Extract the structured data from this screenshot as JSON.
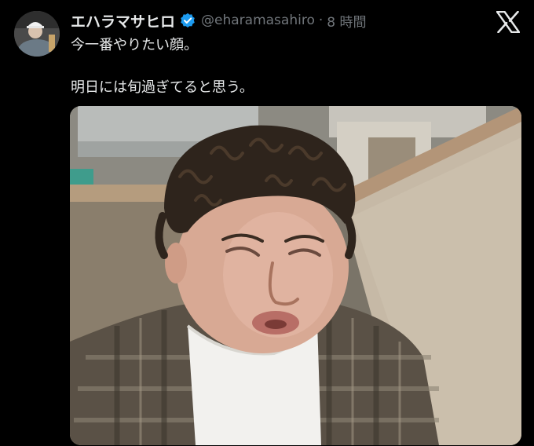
{
  "tweet": {
    "display_name": "エハラマサヒロ",
    "handle": "@eharamasahiro",
    "separator": "·",
    "time": "8 時間",
    "text_line1": "今一番やりたい顔。",
    "text_line2": "明日には旬過ぎてると思う。"
  },
  "icons": {
    "verified": "verified-badge-icon",
    "brand": "x-logo-icon"
  },
  "colors": {
    "background": "#000000",
    "text": "#e7e9ea",
    "muted": "#71767b",
    "verified": "#1d9bf0"
  }
}
